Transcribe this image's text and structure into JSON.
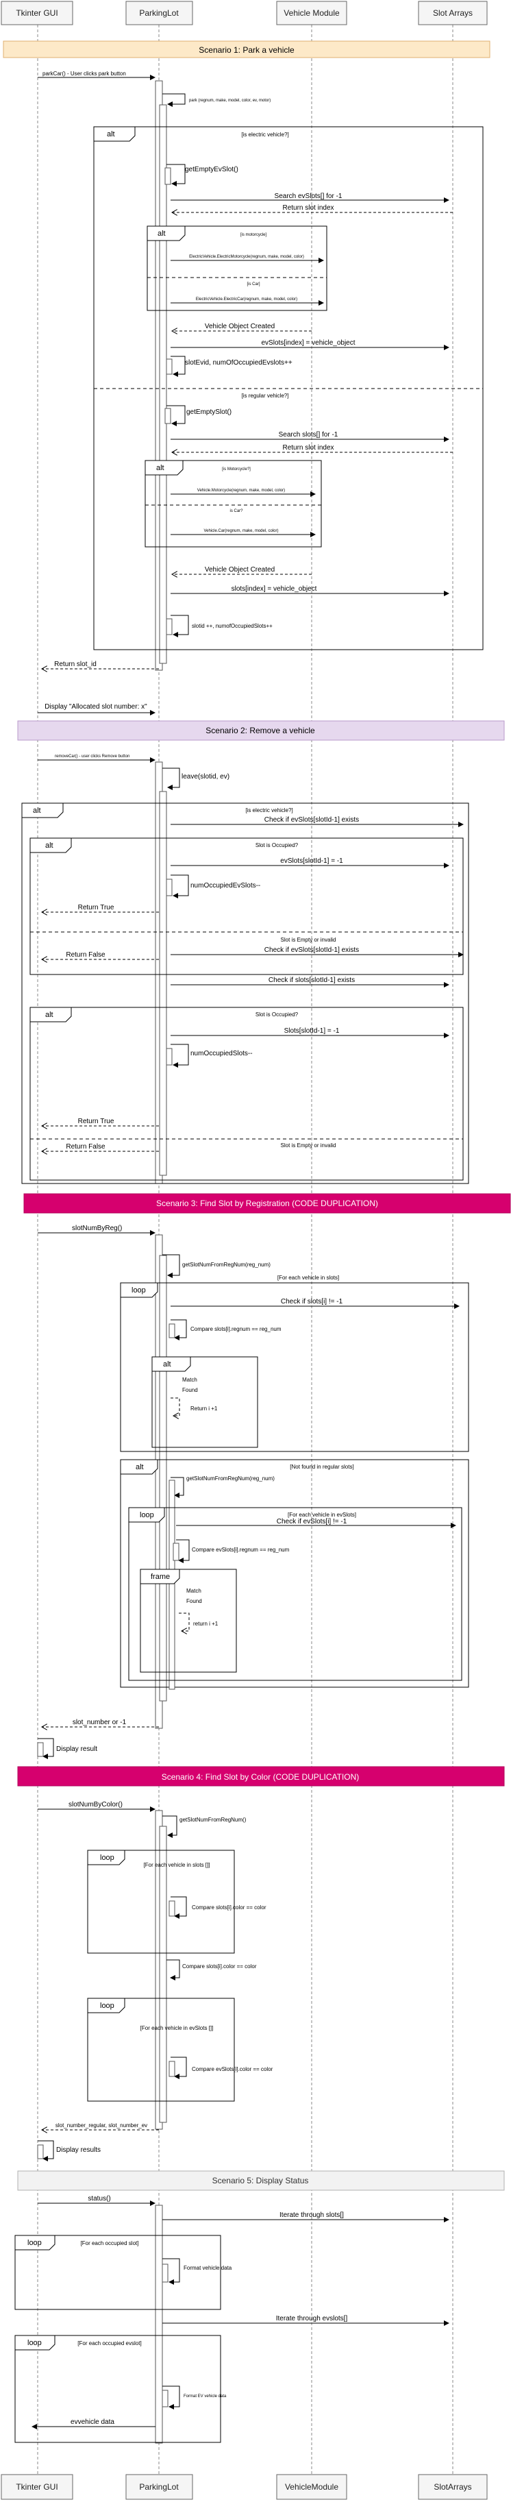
{
  "actors": [
    {
      "key": "gui",
      "label": "Tkinter GUI"
    },
    {
      "key": "pl",
      "label": "ParkingLot"
    },
    {
      "key": "vm",
      "label": "Vehicle Module"
    },
    {
      "key": "sa",
      "label": "Slot Arrays"
    }
  ],
  "actors_bottom": [
    {
      "key": "gui",
      "label": "Tkinter GUI"
    },
    {
      "key": "pl",
      "label": "ParkingLot"
    },
    {
      "key": "vm",
      "label": "VehicleModule"
    },
    {
      "key": "sa",
      "label": "SlotArrays"
    }
  ],
  "colors": {
    "scenario1_fill": "#fde9c8",
    "scenario1_stroke": "#e0b070",
    "scenario2_fill": "#e6d8ee",
    "scenario2_stroke": "#b89acb",
    "scenario3_fill": "#d6006e",
    "scenario3_stroke": "#b0005a",
    "scenario4_fill": "#d6006e",
    "scenario4_stroke": "#b0005a",
    "scenario5_fill": "#f2f2f2",
    "scenario5_stroke": "#b0b0b0",
    "light_text": "#ffffff",
    "dark_text": "#000000"
  },
  "scenarios": {
    "s1": "Scenario 1: Park a vehicle",
    "s2": "Scenario 2: Remove a vehicle",
    "s3": "Scenario 3: Find Slot by Registration (CODE DUPLICATION)",
    "s4": "Scenario 4: Find Slot by Color (CODE DUPLICATION)",
    "s5": "Scenario 5: Display Status"
  },
  "frames": {
    "alt": "alt",
    "loop": "loop",
    "frame": "frame"
  },
  "messages": {
    "s1_park": "parkCar() - User clicks park button",
    "s1_self1": "park (regnum, make, model, color, ev, motor)",
    "s1_cond_ev": "[is electric vehicle?]",
    "s1_getEmptyEv": "getEmptyEvSlot()",
    "s1_searchEv": "Search evSlots[] for -1",
    "s1_returnSlot": "Return slot index",
    "s1_cond_moto": "[is motorcycle]",
    "s1_createMotoEv": "ElectricVehicle.ElectricMotorcycle(regnum, make, model, color)",
    "s1_cond_car": "[is Car]",
    "s1_createCarEv": "ElectricVehicle.ElectricCar(regnum, make, model, color)",
    "s1_vehicleCreated": "Vehicle Object Created",
    "s1_evAssign": "evSlots[index] = vehicle_object",
    "s1_evIncr": "slotEvid, numOfOccupiedEvslots++",
    "s1_cond_reg": "[is regular vehicle?]",
    "s1_getEmpty": "getEmptySlot()",
    "s1_searchReg": "Search slots[] for -1",
    "s1_returnSlot2": "Return slot index",
    "s1_cond_moto2": "[is Motorcycle?]",
    "s1_createMoto": "Vehicle.Motorcycle(regnum, make, model, color)",
    "s1_cond_car2": "is Car?",
    "s1_createCar": "Vehicle.Car(regnum, make, model, color)",
    "s1_vehicleCreated2": "Vehicle Object Created",
    "s1_regAssign": "slots[index] = vehicle_object",
    "s1_regIncr": "slotid ++, numofOccupiedSlots++",
    "s1_returnId": "Return slot_id",
    "s1_display": "Display \"Allocated slot number: x\"",
    "s2_remove": "removeCar() - user clicks Remove button",
    "s2_leave": "leave(slotid, ev)",
    "s2_cond_ev": "[is electric vehicle?]",
    "s2_checkEv": "Check if evSlots[slotId-1] exists",
    "s2_cond_occ": "Slot is Occupied?",
    "s2_evSet": "evSlots[slotId-1] = -1",
    "s2_evDecr": "numOccupiedEvSlots--",
    "s2_returnTrue": "Return True",
    "s2_cond_empty": "Slot is Empty or invalid",
    "s2_checkEv2": "Check if evSlots[slotId-1] exists",
    "s2_returnFalse": "Return False",
    "s2_checkReg": "Check if slots[slotId-1] exists",
    "s2_cond_occ2": "Slot is Occupied?",
    "s2_regSet": "Slots[slotId-1] = -1",
    "s2_regDecr": "numOccupiedSlots--",
    "s2_returnTrue2": "Return True",
    "s2_returnFalse2": "Return False",
    "s2_cond_empty2": "Slot is Empty or invalid",
    "s3_call": "slotNumByReg()",
    "s3_getFrom": "getSlotNumFromRegNum(reg_num)",
    "s3_loop_cond": "[For each vehicle in slots]",
    "s3_check": "Check if slots[i] != -1",
    "s3_compare": "Compare slots[i].regnum == reg_num",
    "s3_match": "Match",
    "s3_found": "Found",
    "s3_return": "Return i +1",
    "s3_alt_cond": "[Not found in regular slots]",
    "s3_getFromEv": "getSlotNumFromRegNum(reg_num)",
    "s3_loop_ev": "[For each vehicle in evSlots]",
    "s3_checkEv": "Check if evSlots[i] != -1",
    "s3_compareEv": "Compare evSlots[i].regnum == reg_num",
    "s3_match2": "Match",
    "s3_found2": "Found",
    "s3_return2": "return i +1",
    "s3_result": "slot_number or -1",
    "s3_display": "Display result",
    "s4_call": "slotNumByColor()",
    "s4_getFrom": "getSlotNumFromRegNum()",
    "s4_loop1": "[For each vehicle in slots []]",
    "s4_compare1": "Compare slots[i].color == color",
    "s4_compare2": "Compare slots[i].color == color",
    "s4_loop2": "[For each vehicle in evSlots []]",
    "s4_compare3": "Compare evSlots[i].color == color",
    "s4_result": "slot_number_regular, slot_number_ev",
    "s4_display": "Display results",
    "s5_status": "status()",
    "s5_iterSlots": "Iterate through slots[]",
    "s5_loop1": "[For each occupied slot]",
    "s5_format1": "Format vehicle data",
    "s5_iterEv": "Iterate through evslots[]",
    "s5_loop2": "[For each occupied evslot]",
    "s5_format2": "Format EV vehicle data",
    "s5_evData": "evvehicle data"
  }
}
